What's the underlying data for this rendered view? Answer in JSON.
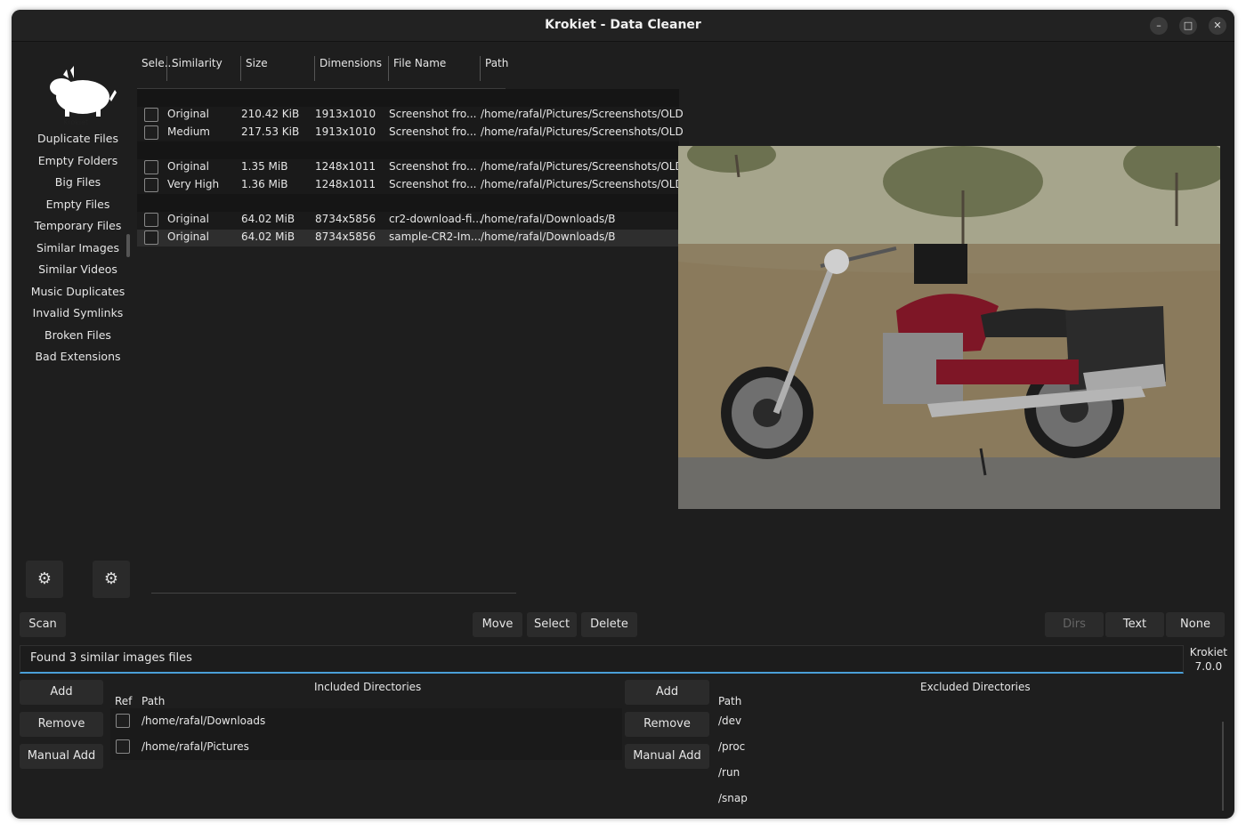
{
  "window": {
    "title": "Krokiet - Data Cleaner",
    "controls": {
      "minimize": "–",
      "maximize": "□",
      "close": "✕"
    }
  },
  "logo": {
    "text": "Krokiet"
  },
  "sidebar": {
    "items": [
      {
        "label": "Duplicate Files"
      },
      {
        "label": "Empty Folders"
      },
      {
        "label": "Big Files"
      },
      {
        "label": "Empty Files"
      },
      {
        "label": "Temporary Files"
      },
      {
        "label": "Similar Images",
        "active": true
      },
      {
        "label": "Similar Videos"
      },
      {
        "label": "Music Duplicates"
      },
      {
        "label": "Invalid Symlinks"
      },
      {
        "label": "Broken Files"
      },
      {
        "label": "Bad Extensions"
      }
    ]
  },
  "table": {
    "headers": {
      "select": "Sele...",
      "similarity": "Similarity",
      "size": "Size",
      "dimensions": "Dimensions",
      "filename": "File Name",
      "path": "Path"
    },
    "groups": [
      {
        "rows": [
          {
            "similarity": "Original",
            "size": "210.42 KiB",
            "dimensions": "1913x1010",
            "filename": "Screenshot fro...",
            "path": "/home/rafal/Pictures/Screenshots/OLD"
          },
          {
            "similarity": "Medium",
            "size": "217.53 KiB",
            "dimensions": "1913x1010",
            "filename": "Screenshot fro...",
            "path": "/home/rafal/Pictures/Screenshots/OLD"
          }
        ]
      },
      {
        "rows": [
          {
            "similarity": "Original",
            "size": "1.35 MiB",
            "dimensions": "1248x1011",
            "filename": "Screenshot fro...",
            "path": "/home/rafal/Pictures/Screenshots/OLD"
          },
          {
            "similarity": "Very High",
            "size": "1.36 MiB",
            "dimensions": "1248x1011",
            "filename": "Screenshot fro...",
            "path": "/home/rafal/Pictures/Screenshots/OLD"
          }
        ]
      },
      {
        "rows": [
          {
            "similarity": "Original",
            "size": "64.02 MiB",
            "dimensions": "8734x5856",
            "filename": "cr2-download-fi...",
            "path": "/home/rafal/Downloads/B"
          },
          {
            "similarity": "Original",
            "size": "64.02 MiB",
            "dimensions": "8734x5856",
            "filename": "sample-CR2-Im...",
            "path": "/home/rafal/Downloads/B",
            "selected": true
          }
        ]
      }
    ]
  },
  "toolbar": {
    "settings_icon": "gear-icon",
    "subsettings_icon": "gear-list-icon",
    "scan": "Scan",
    "move": "Move",
    "select": "Select",
    "delete": "Delete",
    "dirs": "Dirs",
    "text": "Text",
    "none": "None"
  },
  "status": {
    "message": "Found 3 similar images files",
    "app_name": "Krokiet",
    "version": "7.0.0"
  },
  "included": {
    "title": "Included Directories",
    "add": "Add",
    "remove": "Remove",
    "manual_add": "Manual Add",
    "col_ref": "Ref",
    "col_path": "Path",
    "paths": [
      "/home/rafal/Downloads",
      "/home/rafal/Pictures"
    ]
  },
  "excluded": {
    "title": "Excluded Directories",
    "add": "Add",
    "remove": "Remove",
    "manual_add": "Manual Add",
    "col_path": "Path",
    "paths": [
      "/dev",
      "/proc",
      "/run",
      "/snap"
    ]
  },
  "colors": {
    "window_bg": "#1e1e1e",
    "accent": "#4a9fd8",
    "motorcycle_red": "#7e1626"
  }
}
